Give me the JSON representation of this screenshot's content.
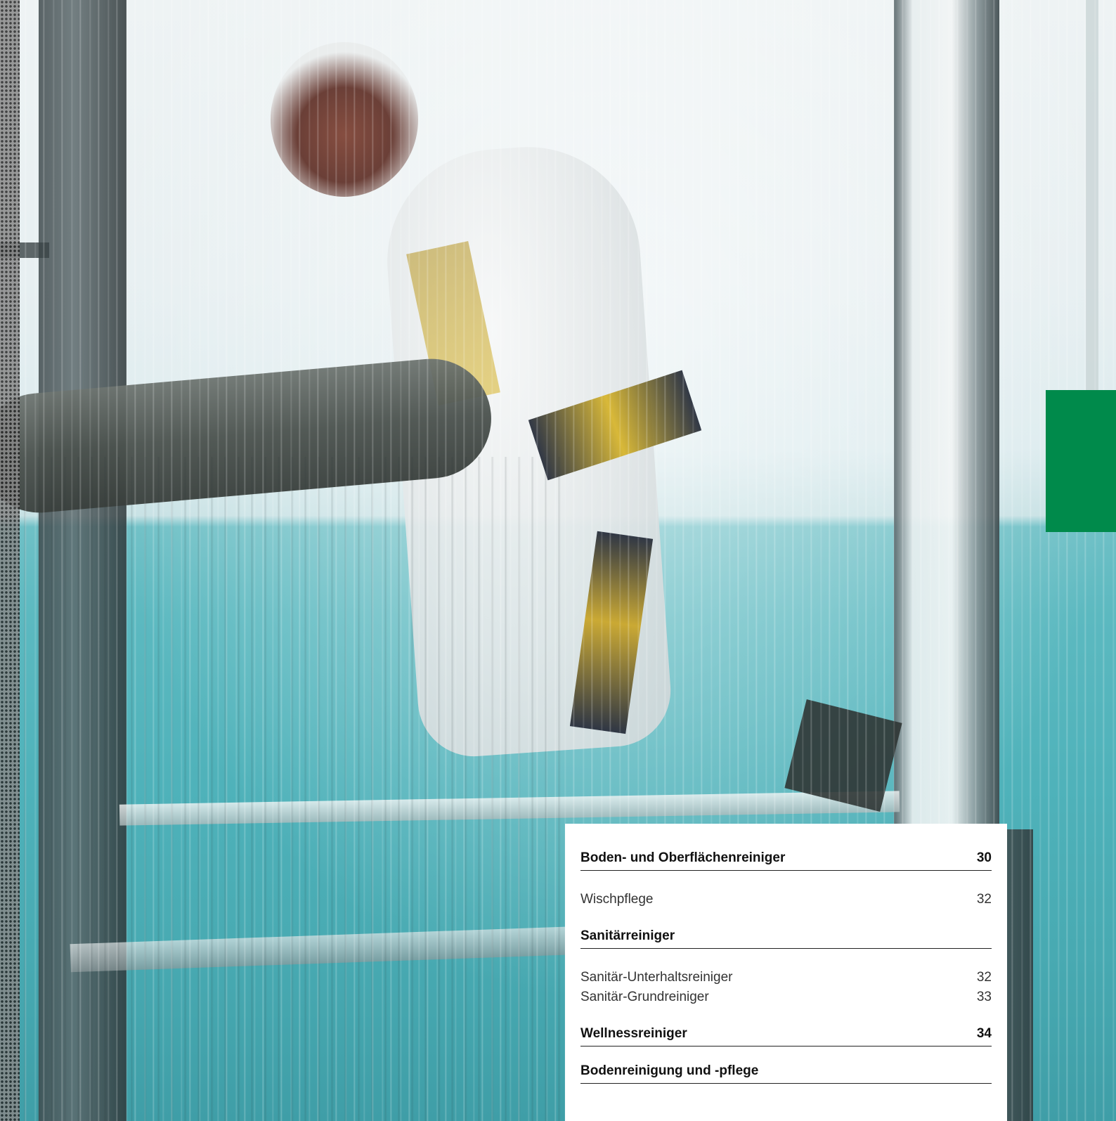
{
  "accent_color": "#008a4b",
  "toc": {
    "sections": [
      {
        "title": "Boden- und Oberflächenreiniger",
        "page": "30",
        "items": [
          {
            "label": "Wischpflege",
            "page": "32"
          }
        ]
      },
      {
        "title": "Sanitärreiniger",
        "page": "",
        "items": [
          {
            "label": "Sanitär-Unterhaltsreiniger",
            "page": "32"
          },
          {
            "label": "Sanitär-Grundreiniger",
            "page": "33"
          }
        ]
      },
      {
        "title": "Wellnessreiniger",
        "page": "34",
        "items": []
      },
      {
        "title": "Bodenreinigung und -pflege",
        "page": "",
        "items": []
      }
    ]
  }
}
